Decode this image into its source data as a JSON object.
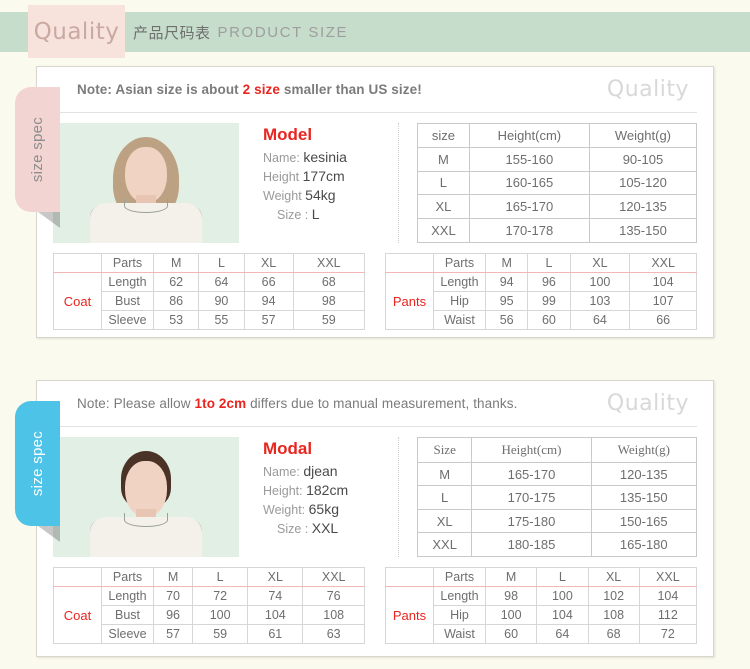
{
  "banner": {
    "badge": "Quality",
    "title_cn": "产品尺码表",
    "title_en": "PRODUCT  SIZE"
  },
  "watermark": "Quality",
  "side_tab_label": "size spec",
  "colors": {
    "banner_bg": "#c6ddcb",
    "badge_bg": "#f7e2dc",
    "tab_pink": "#f2d5d2",
    "tab_blue": "#4ec3e8",
    "accent_red": "#e8251f",
    "page_bg": "#fbfaef",
    "photo_bg": "#e2efe5"
  },
  "sections": [
    {
      "note": {
        "prefix": "Note:  Asian size is about",
        "highlight": "2 size",
        "suffix": "smaller than US size!"
      },
      "model": {
        "title": "Model",
        "name_label": "Name:",
        "name_value": "kesinia",
        "height_label": "Height",
        "height_value": "177cm",
        "weight_label": "Weight",
        "weight_value": "54kg",
        "size_label": "Size :",
        "size_value": "L"
      },
      "size_table": {
        "headers": [
          "size",
          "Height(cm)",
          "Weight(g)"
        ],
        "rows": [
          [
            "M",
            "155-160",
            "90-105"
          ],
          [
            "L",
            "160-165",
            "105-120"
          ],
          [
            "XL",
            "165-170",
            "120-135"
          ],
          [
            "XXL",
            "170-178",
            "135-150"
          ]
        ]
      },
      "coat": {
        "category": "Coat",
        "headers": [
          "Parts",
          "M",
          "L",
          "XL",
          "XXL"
        ],
        "rows": [
          [
            "Length",
            "62",
            "64",
            "66",
            "68"
          ],
          [
            "Bust",
            "86",
            "90",
            "94",
            "98"
          ],
          [
            "Sleeve",
            "53",
            "55",
            "57",
            "59"
          ]
        ]
      },
      "pants": {
        "category": "Pants",
        "headers": [
          "Parts",
          "M",
          "L",
          "XL",
          "XXL"
        ],
        "rows": [
          [
            "Length",
            "94",
            "96",
            "100",
            "104"
          ],
          [
            "Hip",
            "95",
            "99",
            "103",
            "107"
          ],
          [
            "Waist",
            "56",
            "60",
            "64",
            "66"
          ]
        ]
      }
    },
    {
      "note": {
        "prefix": "Note: Please allow",
        "highlight": "1to 2cm",
        "suffix": "differs due to manual measurement, thanks."
      },
      "model": {
        "title": "Modal",
        "name_label": "Name:",
        "name_value": "djean",
        "height_label": "Height:",
        "height_value": "182cm",
        "weight_label": "Weight:",
        "weight_value": "65kg",
        "size_label": "Size :",
        "size_value": "XXL"
      },
      "size_table": {
        "headers": [
          "Size",
          "Height(cm)",
          "Weight(g)"
        ],
        "rows": [
          [
            "M",
            "165-170",
            "120-135"
          ],
          [
            "L",
            "170-175",
            "135-150"
          ],
          [
            "XL",
            "175-180",
            "150-165"
          ],
          [
            "XXL",
            "180-185",
            "165-180"
          ]
        ]
      },
      "coat": {
        "category": "Coat",
        "headers": [
          "Parts",
          "M",
          "L",
          "XL",
          "XXL"
        ],
        "rows": [
          [
            "Length",
            "70",
            "72",
            "74",
            "76"
          ],
          [
            "Bust",
            "96",
            "100",
            "104",
            "108"
          ],
          [
            "Sleeve",
            "57",
            "59",
            "61",
            "63"
          ]
        ]
      },
      "pants": {
        "category": "Pants",
        "headers": [
          "Parts",
          "M",
          "L",
          "XL",
          "XXL"
        ],
        "rows": [
          [
            "Length",
            "98",
            "100",
            "102",
            "104"
          ],
          [
            "Hip",
            "100",
            "104",
            "108",
            "112"
          ],
          [
            "Waist",
            "60",
            "64",
            "68",
            "72"
          ]
        ]
      }
    }
  ]
}
